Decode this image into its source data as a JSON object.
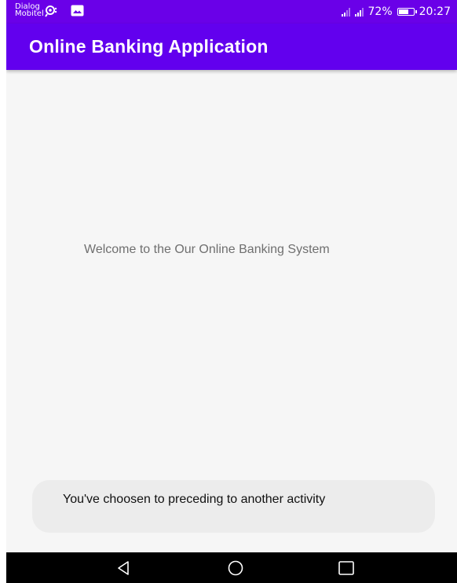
{
  "status_bar": {
    "carrier": "Dialog\nMobitel",
    "battery_percent": "72%",
    "battery_level": 0.72,
    "time": "20:27",
    "icons": [
      "lens-icon",
      "image-icon",
      "signal-icon",
      "signal-icon",
      "battery-icon"
    ]
  },
  "app_bar": {
    "title": "Online Banking Application"
  },
  "main": {
    "welcome_text": "Welcome to the Our Online Banking System"
  },
  "toast": {
    "message": "You've choosen to preceding to another activity"
  },
  "nav_bar": {
    "buttons": [
      "back-icon",
      "home-icon",
      "recents-icon"
    ]
  },
  "colors": {
    "status_bar": "#6a00e8",
    "app_bar": "#6200ee",
    "background": "#f6f6f6",
    "toast_background": "#ececec",
    "nav_bar": "#000000"
  }
}
